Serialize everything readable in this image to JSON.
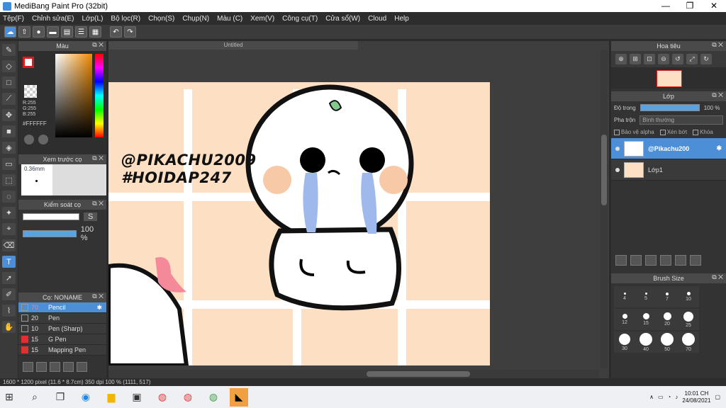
{
  "window": {
    "title": "MediBang Paint Pro (32bit)",
    "minimize_icon": "—",
    "maximize_icon": "❐",
    "close_icon": "✕"
  },
  "menu": [
    "Tệp(F)",
    "Chỉnh sửa(E)",
    "Lớp(L)",
    "Bộ lọc(R)",
    "Chọn(S)",
    "Chụp(N)",
    "Màu (C)",
    "Xem(V)",
    "Công cụ(T)",
    "Cửa sổ(W)",
    "Cloud",
    "Help"
  ],
  "document": {
    "tab_title": "Untitled",
    "watermark_line1": "@PIKACHU2009",
    "watermark_line2": "#HOIDAP247"
  },
  "color_panel": {
    "title": "Màu",
    "r": "R:255",
    "g": "G:255",
    "b": "B:255",
    "hex": "#FFFFFF"
  },
  "brush_preview": {
    "title": "Xem trước cọ",
    "size": "0.36mm"
  },
  "brush_control": {
    "title": "Kiểm soát cọ",
    "opacity_label": "100 %",
    "s_label": "S"
  },
  "brush_panel": {
    "title": "Cọ: NONAME",
    "items": [
      {
        "size": "70",
        "name": "Pencil",
        "selected": true,
        "color": "#333"
      },
      {
        "size": "20",
        "name": "Pen",
        "selected": false,
        "color": "#333"
      },
      {
        "size": "10",
        "name": "Pen (Sharp)",
        "selected": false,
        "color": "#333"
      },
      {
        "size": "15",
        "name": "G Pen",
        "selected": false,
        "color": "#e03030"
      },
      {
        "size": "15",
        "name": "Mapping Pen",
        "selected": false,
        "color": "#e03030"
      }
    ]
  },
  "navigator": {
    "title": "Hoa tiêu"
  },
  "layer_panel": {
    "title": "Lớp",
    "opacity_label": "Độ trong",
    "opacity_value": "100 %",
    "blend_label": "Pha trộn",
    "blend_value": "Bình thường",
    "protect_alpha": "Bảo vệ alpha",
    "clipping": "Xén bớt",
    "lock": "Khóa",
    "layers": [
      {
        "name": "@Pikachu200",
        "selected": true
      },
      {
        "name": "Lớp1",
        "selected": false
      }
    ]
  },
  "brush_size_panel": {
    "title": "Brush Size",
    "sizes": [
      "4",
      "5",
      "7",
      "10",
      "12",
      "15",
      "20",
      "25",
      "30",
      "40",
      "50",
      "70",
      "",
      "",
      "",
      ""
    ]
  },
  "status": {
    "text": "1600 * 1200 pixel   (11.6 * 8.7cm)   350 dpi   100 %   (1111, 517)"
  },
  "taskbar": {
    "time": "10:01 CH",
    "date": "24/08/2021"
  }
}
